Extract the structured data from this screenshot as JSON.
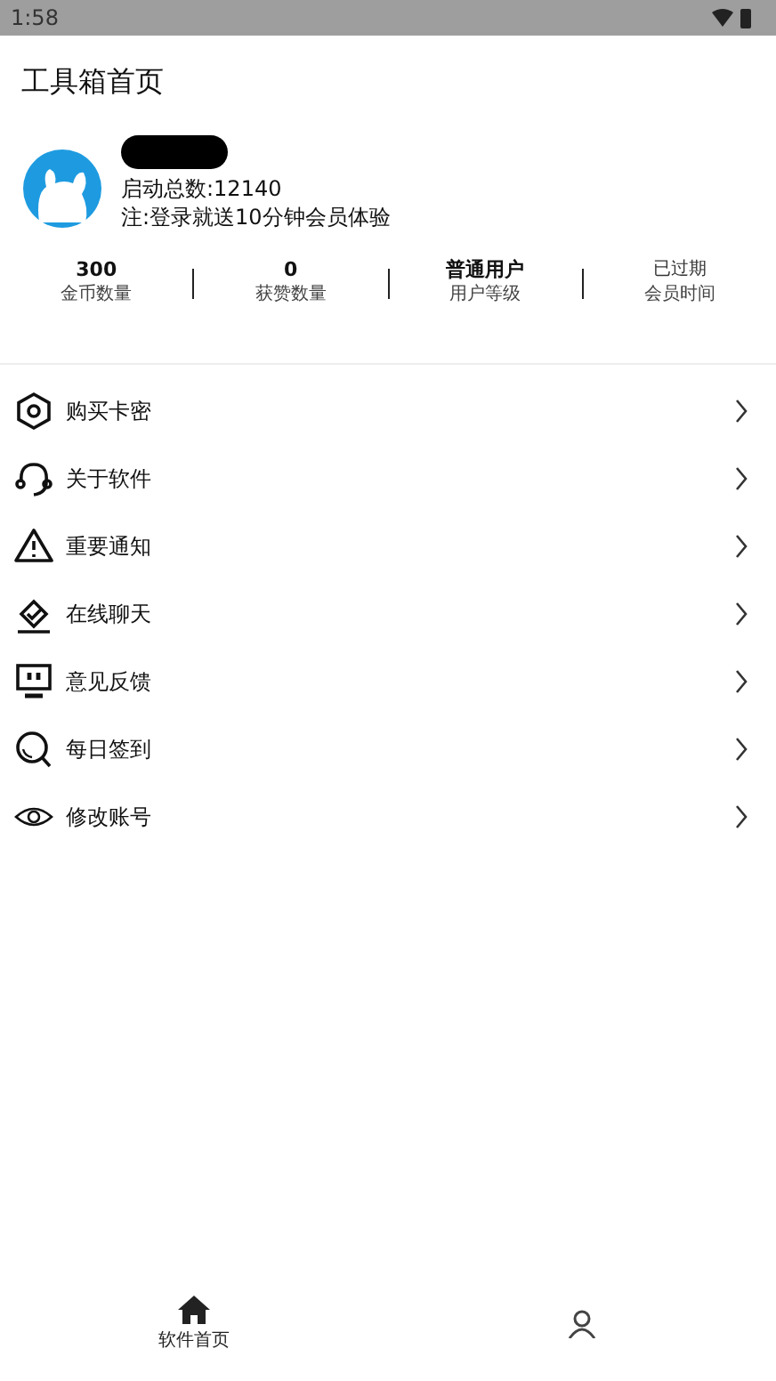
{
  "status_bar": {
    "time": "1:58"
  },
  "title": "工具箱首页",
  "user": {
    "name_redacted": true,
    "launch_count": "启动总数:12140",
    "note": "注:登录就送10分钟会员体验"
  },
  "stats": [
    {
      "value": "300",
      "label": "金币数量",
      "kind": "bold"
    },
    {
      "value": "0",
      "label": "获赞数量",
      "kind": "bold"
    },
    {
      "value": "普通用户",
      "label": "用户等级",
      "kind": "bold"
    },
    {
      "value": "已过期",
      "label": "会员时间",
      "kind": "plain"
    }
  ],
  "menu": [
    {
      "label": "购买卡密"
    },
    {
      "label": "关于软件"
    },
    {
      "label": "重要通知"
    },
    {
      "label": "在线聊天"
    },
    {
      "label": "意见反馈"
    },
    {
      "label": "每日签到"
    },
    {
      "label": "修改账号"
    }
  ],
  "nav": [
    {
      "label": "软件首页"
    }
  ]
}
